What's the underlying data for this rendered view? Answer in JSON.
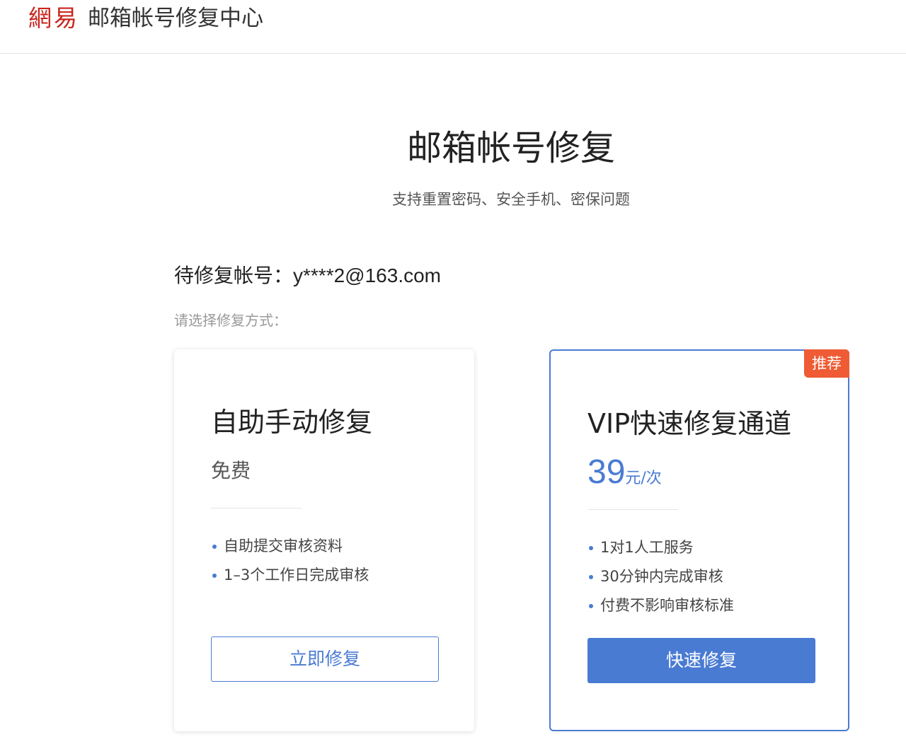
{
  "header": {
    "logo": "網易",
    "title": "邮箱帐号修复中心"
  },
  "main": {
    "title": "邮箱帐号修复",
    "subtitle": "支持重置密码、安全手机、密保问题",
    "account_label": "待修复帐号：",
    "account_value": "y****2@163.com",
    "choose_label": "请选择修复方式："
  },
  "cards": {
    "free": {
      "title": "自助手动修复",
      "price": "免费",
      "features": [
        "自助提交审核资料",
        "1–3个工作日完成审核"
      ],
      "button": "立即修复"
    },
    "vip": {
      "badge": "推荐",
      "title": "VIP快速修复通道",
      "price_number": "39",
      "price_unit": "元/次",
      "features": [
        "1对1人工服务",
        "30分钟内完成审核",
        "付费不影响审核标准"
      ],
      "button": "快速修复"
    }
  },
  "colors": {
    "accent": "#4a7bd3",
    "logo": "#c8261f",
    "badge": "#ef5b34"
  }
}
